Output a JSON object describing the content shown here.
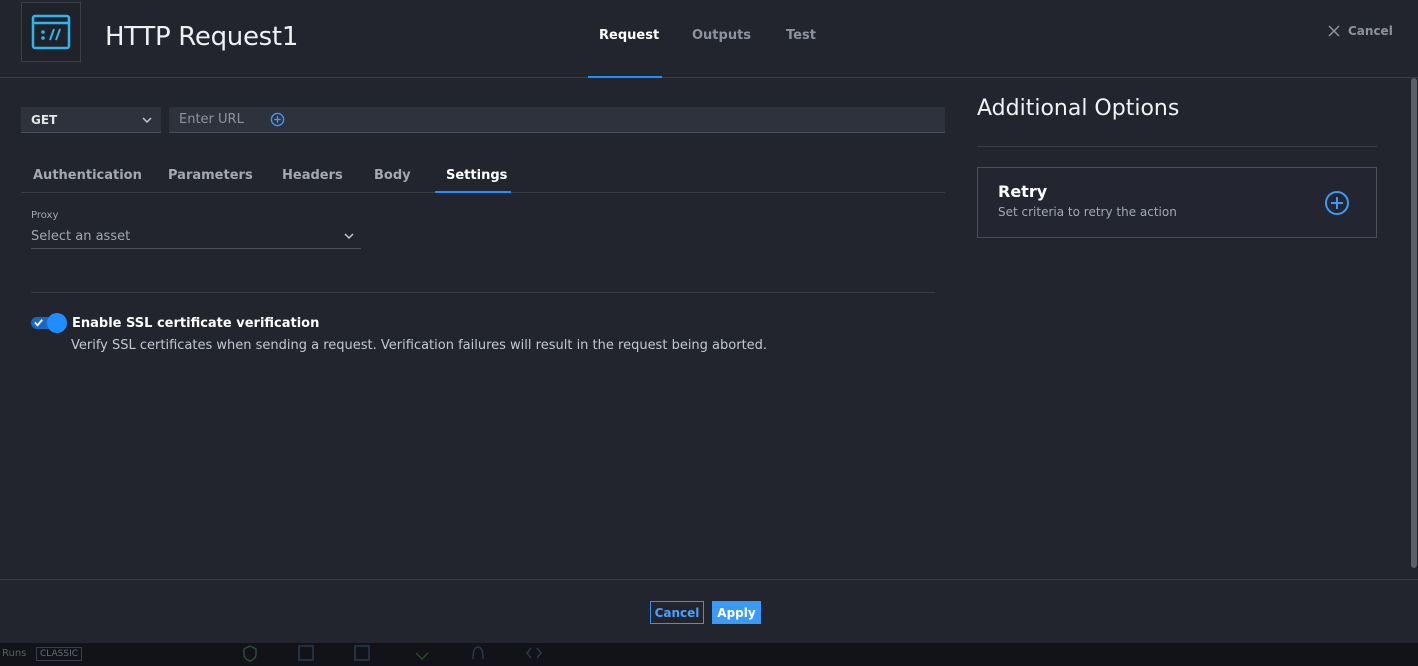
{
  "header": {
    "app_icon": "http-request-icon",
    "title": "HTTP Request1",
    "tabs": [
      {
        "label": "Request",
        "active": true
      },
      {
        "label": "Outputs",
        "active": false
      },
      {
        "label": "Test",
        "active": false
      }
    ],
    "cancel_label": "Cancel"
  },
  "request": {
    "method": "GET",
    "url_placeholder": "Enter URL",
    "url_value": ""
  },
  "sub_tabs": [
    {
      "label": "Authentication",
      "active": false
    },
    {
      "label": "Parameters",
      "active": false
    },
    {
      "label": "Headers",
      "active": false
    },
    {
      "label": "Body",
      "active": false
    },
    {
      "label": "Settings",
      "active": true
    }
  ],
  "settings": {
    "proxy_label": "Proxy",
    "proxy_placeholder": "Select an asset",
    "ssl_toggle_on": true,
    "ssl_title": "Enable SSL certificate verification",
    "ssl_description": "Verify SSL certificates when sending a request. Verification failures will result in the request being aborted."
  },
  "additional_options": {
    "title": "Additional Options",
    "retry": {
      "title": "Retry",
      "description": "Set criteria to retry the action"
    }
  },
  "footer": {
    "cancel_label": "Cancel",
    "apply_label": "Apply"
  },
  "bottom_strip": {
    "label": "Runs",
    "badge": "CLASSIC"
  },
  "colors": {
    "accent": "#1f8fff",
    "background": "#22252e",
    "apply_button": "#3a9af5"
  }
}
